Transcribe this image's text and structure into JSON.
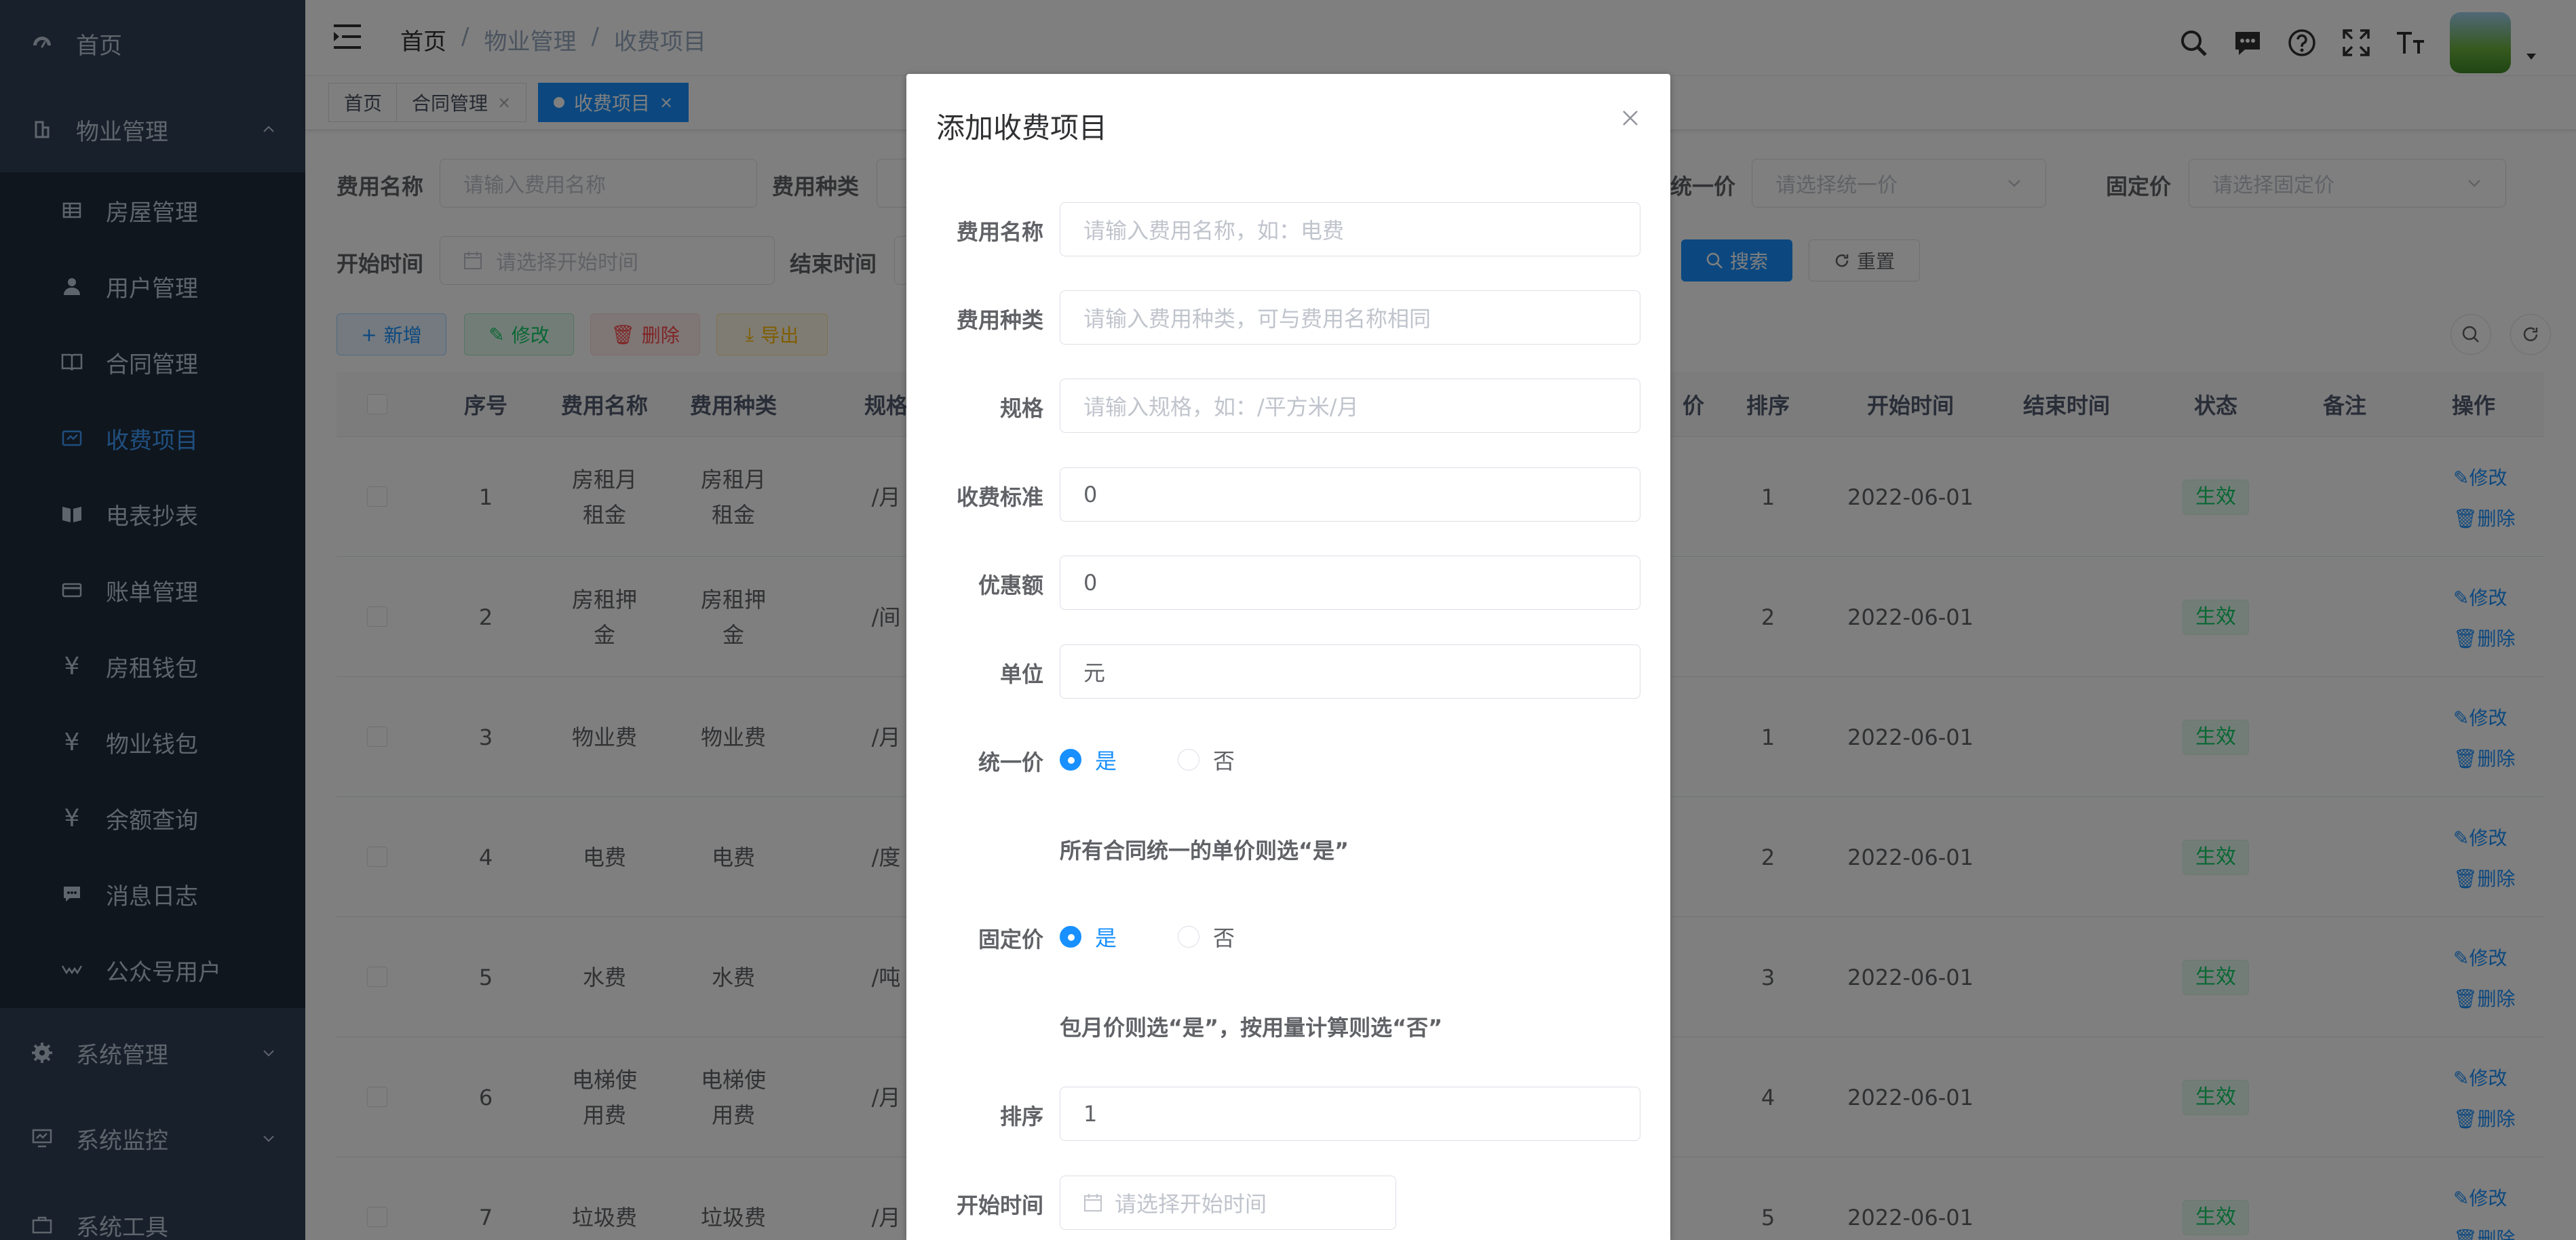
{
  "sidebar": {
    "items": [
      {
        "label": "首页",
        "icon": "dashboard-icon"
      },
      {
        "label": "物业管理",
        "icon": "building-icon",
        "expanded": true
      },
      {
        "label": "房屋管理",
        "icon": "table-icon"
      },
      {
        "label": "用户管理",
        "icon": "user-icon"
      },
      {
        "label": "合同管理",
        "icon": "book-icon"
      },
      {
        "label": "收费项目",
        "icon": "money-icon",
        "active": true
      },
      {
        "label": "电表抄表",
        "icon": "book-open-icon"
      },
      {
        "label": "账单管理",
        "icon": "credit-card-icon"
      },
      {
        "label": "房租钱包",
        "icon": "yen-icon"
      },
      {
        "label": "物业钱包",
        "icon": "yen-icon"
      },
      {
        "label": "余额查询",
        "icon": "yen-icon"
      },
      {
        "label": "消息日志",
        "icon": "message-icon"
      },
      {
        "label": "公众号用户",
        "icon": "wechat-icon"
      },
      {
        "label": "系统管理",
        "icon": "gear-icon"
      },
      {
        "label": "系统监控",
        "icon": "monitor-icon"
      },
      {
        "label": "系统工具",
        "icon": "tool-icon"
      }
    ]
  },
  "navbar": {
    "breadcrumb": [
      "首页",
      "/",
      "物业管理",
      "/",
      "收费项目"
    ]
  },
  "tags": [
    {
      "label": "首页"
    },
    {
      "label": "合同管理",
      "close": "×"
    },
    {
      "label": "收费项目",
      "close": "×",
      "active": true
    }
  ],
  "search": {
    "name_label": "费用名称",
    "name_placeholder": "请输入费用名称",
    "type_label": "费用种类",
    "unified_label": "统一价",
    "unified_placeholder": "请选择统一价",
    "fixed_label": "固定价",
    "fixed_placeholder": "请选择固定价",
    "start_label": "开始时间",
    "start_placeholder": "请选择开始时间",
    "end_label": "结束时间",
    "search_btn": "搜索",
    "reset_btn": "重置"
  },
  "toolbar": {
    "add": "新增",
    "edit": "修改",
    "delete": "删除",
    "export": "导出"
  },
  "table": {
    "headers": [
      "序号",
      "费用名称",
      "费用种类",
      "规格",
      "价",
      "排序",
      "开始时间",
      "结束时间",
      "状态",
      "备注",
      "操作"
    ],
    "rows": [
      {
        "no": "1",
        "name": "房租月租金",
        "type": "房租月租金",
        "spec": "/月",
        "sort": "1",
        "start": "2022-06-01",
        "status": "生效"
      },
      {
        "no": "2",
        "name": "房租押金",
        "type": "房租押金",
        "spec": "/间",
        "sort": "2",
        "start": "2022-06-01",
        "status": "生效"
      },
      {
        "no": "3",
        "name": "物业费",
        "type": "物业费",
        "spec": "/月",
        "sort": "1",
        "start": "2022-06-01",
        "status": "生效"
      },
      {
        "no": "4",
        "name": "电费",
        "type": "电费",
        "spec": "/度",
        "sort": "2",
        "start": "2022-06-01",
        "status": "生效"
      },
      {
        "no": "5",
        "name": "水费",
        "type": "水费",
        "spec": "/吨",
        "sort": "3",
        "start": "2022-06-01",
        "status": "生效"
      },
      {
        "no": "6",
        "name": "电梯使用费",
        "type": "电梯使用费",
        "spec": "/月",
        "sort": "4",
        "start": "2022-06-01",
        "status": "生效"
      },
      {
        "no": "7",
        "name": "垃圾费",
        "type": "垃圾费",
        "spec": "/月",
        "sort": "5",
        "start": "2022-06-01",
        "status": "生效"
      }
    ],
    "op_edit": "修改",
    "op_delete": "删除"
  },
  "dialog": {
    "title": "添加收费项目",
    "close": "×",
    "fields": {
      "name_label": "费用名称",
      "name_placeholder": "请输入费用名称，如：电费",
      "type_label": "费用种类",
      "type_placeholder": "请输入费用种类，可与费用名称相同",
      "spec_label": "规格",
      "spec_placeholder": "请输入规格，如：/平方米/月",
      "standard_label": "收费标准",
      "standard_value": "0",
      "discount_label": "优惠额",
      "discount_value": "0",
      "unit_label": "单位",
      "unit_value": "元",
      "unified_label": "统一价",
      "unified_yes": "是",
      "unified_no": "否",
      "unified_hint": "所有合同统一的单价则选“是”",
      "fixed_label": "固定价",
      "fixed_yes": "是",
      "fixed_no": "否",
      "fixed_hint": "包月价则选“是”，按用量计算则选“否”",
      "sort_label": "排序",
      "sort_value": "1",
      "start_label": "开始时间",
      "start_placeholder": "请选择开始时间"
    }
  },
  "colors": {
    "sidebar_bg": "#304156",
    "primary": "#1890ff",
    "success": "#13ce66"
  }
}
